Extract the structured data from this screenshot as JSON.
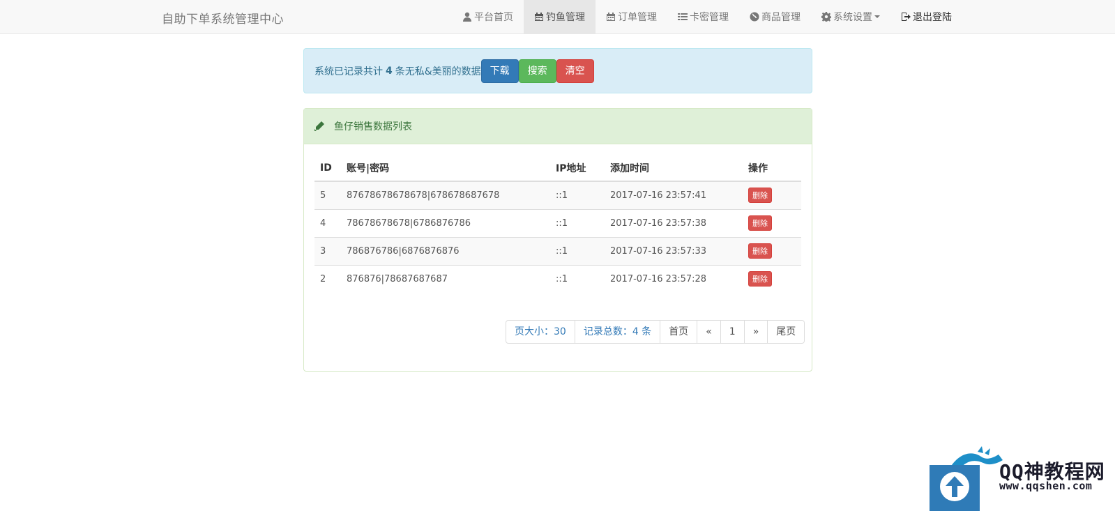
{
  "navbar": {
    "brand": "自助下单系统管理中心",
    "items": [
      {
        "label": "平台首页",
        "icon": "user-icon"
      },
      {
        "label": "钓鱼管理",
        "icon": "calendar-icon",
        "active": true
      },
      {
        "label": "订单管理",
        "icon": "calendar-icon"
      },
      {
        "label": "卡密管理",
        "icon": "list-icon"
      },
      {
        "label": "商品管理",
        "icon": "globe-icon"
      },
      {
        "label": "系统设置",
        "icon": "gear-icon"
      },
      {
        "label": "退出登陆",
        "icon": "logout-icon"
      }
    ]
  },
  "alert": {
    "prefix": "系统已记录共计",
    "count": "4",
    "suffix": "条无私&美丽的数据",
    "buttons": {
      "download": "下载",
      "search": "搜索",
      "clear": "清空"
    }
  },
  "panel": {
    "title": "鱼仔销售数据列表",
    "columns": [
      "ID",
      "账号|密码",
      "IP地址",
      "添加时间",
      "操作"
    ],
    "rows": [
      {
        "id": "5",
        "account": "87678678678678|678678687678",
        "ip": "::1",
        "time": "2017-07-16 23:57:41",
        "action": "删除"
      },
      {
        "id": "4",
        "account": "78678678678|6786876786",
        "ip": "::1",
        "time": "2017-07-16 23:57:38",
        "action": "删除"
      },
      {
        "id": "3",
        "account": "786876786|6876876876",
        "ip": "::1",
        "time": "2017-07-16 23:57:33",
        "action": "删除"
      },
      {
        "id": "2",
        "account": "876876|78687687687",
        "ip": "::1",
        "time": "2017-07-16 23:57:28",
        "action": "删除"
      }
    ]
  },
  "pagination": {
    "page_size": "页大小：30",
    "total": "记录总数：4 条",
    "first": "首页",
    "prev": "«",
    "current": "1",
    "next": "»",
    "last": "尾页"
  },
  "watermark": {
    "name": "QQ神教程网",
    "url": "www.qqshen.com"
  },
  "colors": {
    "primary": "#337ab7",
    "success": "#5cb85c",
    "danger": "#d9534f",
    "info_bg": "#d9edf7",
    "panel_heading_bg": "#dff0d8"
  }
}
